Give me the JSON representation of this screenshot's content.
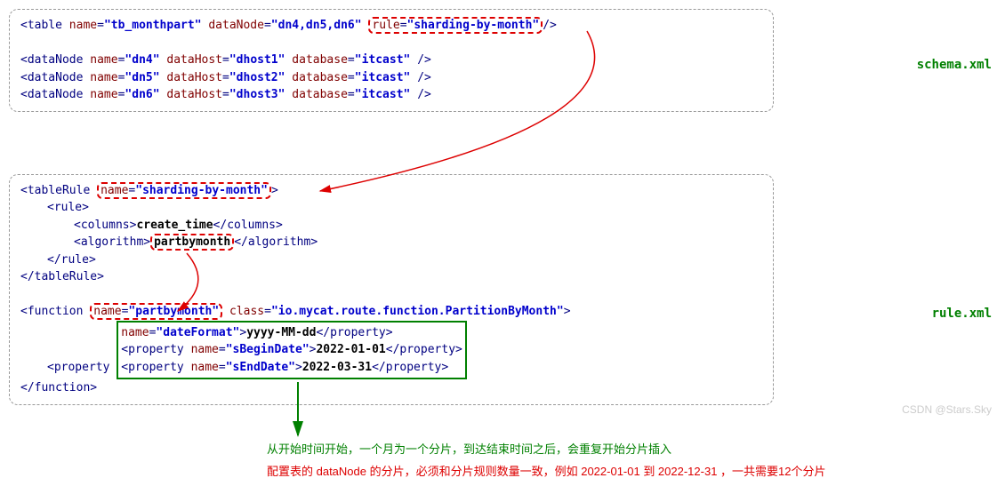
{
  "labels": {
    "schema_file": "schema.xml",
    "rule_file": "rule.xml"
  },
  "schema": {
    "table_tag": "table",
    "table_name_attr": "name",
    "table_name_val": "tb_monthpart",
    "dataNode_attr": "dataNode",
    "dataNode_val": "dn4,dn5,dn6",
    "rule_attr": "rule",
    "rule_val": "sharding-by-month",
    "dn_tag": "dataNode",
    "dn_name_attr": "name",
    "dn_host_attr": "dataHost",
    "dn_db_attr": "database",
    "nodes": [
      {
        "name": "dn4",
        "host": "dhost1",
        "db": "itcast"
      },
      {
        "name": "dn5",
        "host": "dhost2",
        "db": "itcast"
      },
      {
        "name": "dn6",
        "host": "dhost3",
        "db": "itcast"
      }
    ]
  },
  "rule": {
    "tableRule_tag": "tableRule",
    "name_attr": "name",
    "tableRule_name": "sharding-by-month",
    "rule_tag": "rule",
    "columns_tag": "columns",
    "columns_val": "create_time",
    "algorithm_tag": "algorithm",
    "algorithm_val": "partbymonth",
    "function_tag": "function",
    "function_name": "partbymonth",
    "class_attr": "class",
    "class_val": "io.mycat.route.function.PartitionByMonth",
    "property_tag": "property",
    "props": [
      {
        "name": "dateFormat",
        "val": "yyyy-MM-dd"
      },
      {
        "name": "sBeginDate",
        "val": "2022-01-01"
      },
      {
        "name": "sEndDate",
        "val": "2022-03-31"
      }
    ]
  },
  "notes": {
    "green": "从开始时间开始，一个月为一个分片，到达结束时间之后，会重复开始分片插入",
    "red": "配置表的 dataNode 的分片，必须和分片规则数量一致，例如 2022-01-01 到 2022-12-31 ，一共需要12个分片"
  },
  "watermark": "CSDN @Stars.Sky"
}
